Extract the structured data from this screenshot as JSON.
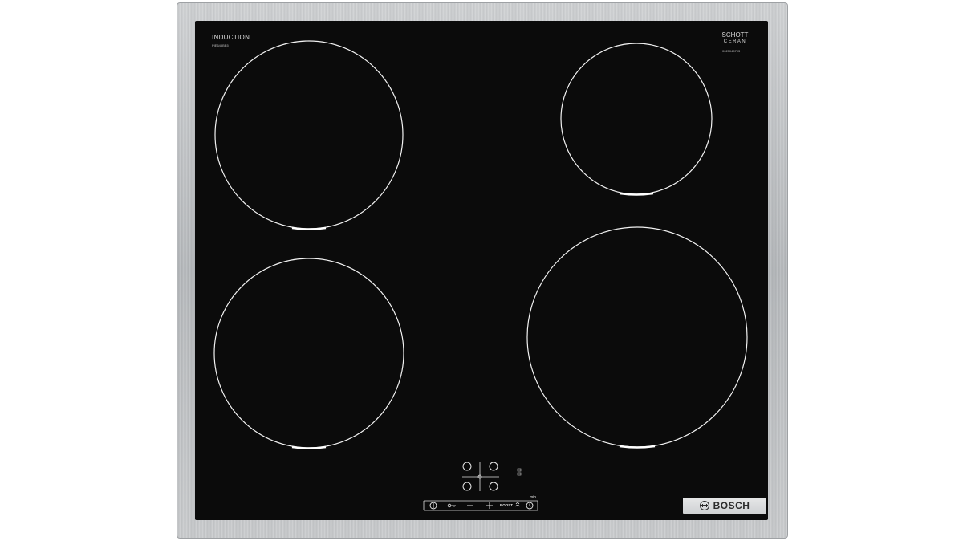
{
  "appliance": {
    "type_label": "INDUCTION",
    "model_code": "PIE645BB5",
    "glass_brand_line1": "SCHOTT",
    "glass_brand_line2": "CERAN",
    "glass_code": "0020045703",
    "manufacturer": "BOSCH"
  },
  "controls": {
    "min_label": "min",
    "boost_label": "BOOST",
    "buttons": [
      {
        "id": "power",
        "icon": "power-icon"
      },
      {
        "id": "lock",
        "icon": "key-lock-icon"
      },
      {
        "id": "minus",
        "icon": "minus-icon"
      },
      {
        "id": "plus",
        "icon": "plus-icon"
      },
      {
        "id": "boost",
        "icon": "boost-icon"
      },
      {
        "id": "timer",
        "icon": "timer-icon"
      }
    ],
    "zone_selectors": [
      "top-left",
      "top-right",
      "bottom-left",
      "bottom-right"
    ]
  },
  "colors": {
    "glass": "#0b0b0b",
    "frame": "#c4c6c8",
    "markings": "#ffffff"
  }
}
